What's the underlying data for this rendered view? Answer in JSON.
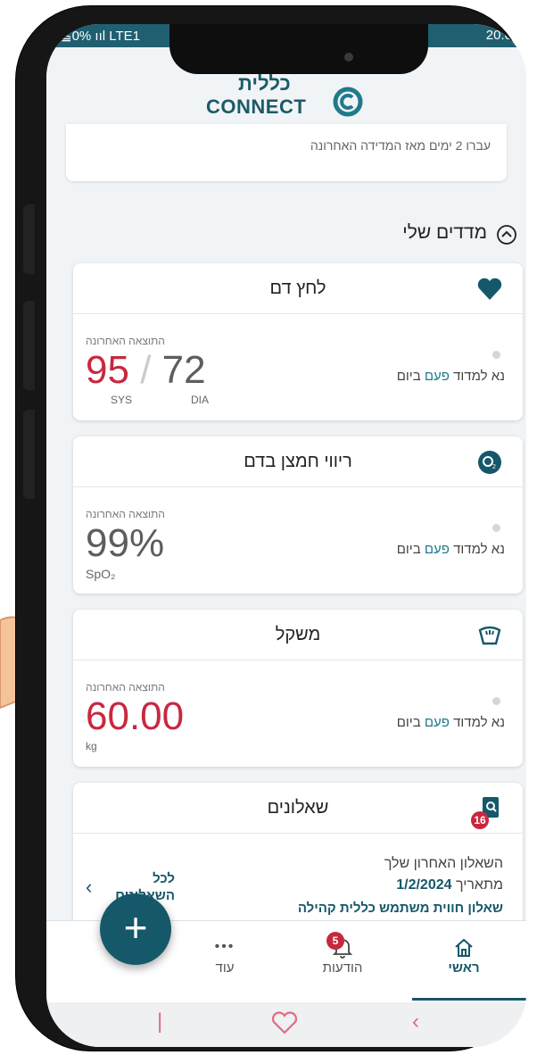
{
  "status": {
    "left": "≦0% ııl LTE1",
    "right": "20:0"
  },
  "app": {
    "logo_he": "כללית",
    "logo_en": "CONNECT"
  },
  "prev_card": {
    "text": "עברו 2 ימים מאז המדידה האחרונה"
  },
  "section": {
    "title": "מדדים שלי"
  },
  "common": {
    "last_result": "התוצאה האחרונה"
  },
  "measure_text": {
    "prefix": "נא למדוד",
    "highlight": "פעם",
    "suffix": "ביום"
  },
  "cards": {
    "blood_pressure": {
      "title": "לחץ דם",
      "sys": "95",
      "slash": "/",
      "dia": "72",
      "sys_label": "SYS",
      "dia_label": "DIA"
    },
    "oxygen": {
      "title": "ריווי חמצן בדם",
      "value": "99%",
      "unit": "SpO₂"
    },
    "weight": {
      "title": "משקל",
      "value": "60.00",
      "unit": "kg"
    }
  },
  "questionnaires": {
    "title": "שאלונים",
    "badge": "16",
    "last_label": "השאלון האחרון שלך",
    "date_prefix": "מתאריך",
    "date": "1/2/2024",
    "link": "שאלון חווית משתמש כללית קהילה",
    "all_line1": "לכל",
    "all_line2": "השאלונים",
    "chevron": "‹"
  },
  "fab": {
    "label": "+"
  },
  "nav": {
    "more": {
      "icon": "•••",
      "label": "עוד"
    },
    "notifications": {
      "label": "הודעות",
      "badge": "5"
    },
    "home": {
      "label": "ראשי"
    }
  },
  "colors": {
    "accent": "#15586a",
    "red": "#c8283f"
  }
}
